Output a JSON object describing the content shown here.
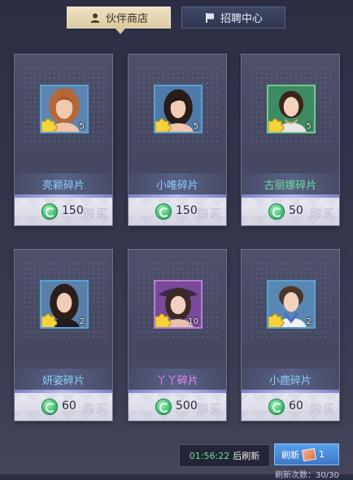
{
  "tabs": {
    "partner_shop": "伙伴商店",
    "recruit_center": "招聘中心"
  },
  "cards": [
    {
      "name": "亮颖碎片",
      "count": "5",
      "price": "150"
    },
    {
      "name": "小唯碎片",
      "count": "5",
      "price": "150"
    },
    {
      "name": "古丽娜碎片",
      "count": "5",
      "price": "50"
    },
    {
      "name": "妍姿碎片",
      "count": "2",
      "price": "60"
    },
    {
      "name": "丫丫碎片",
      "count": "10",
      "price": "500"
    },
    {
      "name": "小鹿碎片",
      "count": "2",
      "price": "60"
    }
  ],
  "buy_label": "购买",
  "footer": {
    "timer": "01:56:22",
    "timer_label": "后刷新",
    "refresh_label": "刷新",
    "refresh_cost": "1",
    "refresh_count": "刷新次数：30/30"
  },
  "colors": {
    "accent_blue": "#8ed0ff",
    "green_name": "#6fe09a",
    "purple_name": "#e98cff",
    "tab_active": "#dcc9a0"
  },
  "icons": [
    "person-icon",
    "flag-icon",
    "puzzle-icon",
    "coin-icon",
    "ticket-icon"
  ]
}
